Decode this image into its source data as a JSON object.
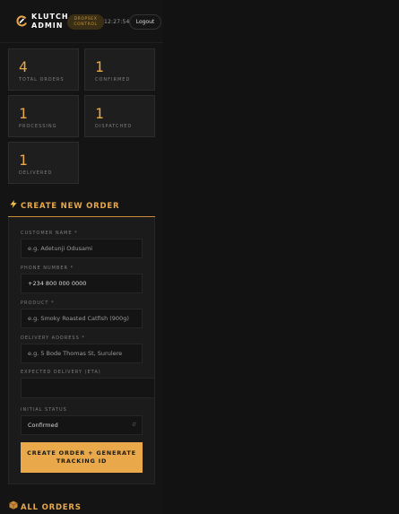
{
  "header": {
    "brand_line1": "KLUTCH",
    "brand_line2": "ADMIN",
    "badge_line1": "DROPSEX",
    "badge_line2": "CONTROL",
    "time": "12:27:54",
    "logout_label": "Logout"
  },
  "stats": [
    {
      "value": "4",
      "label": "TOTAL ORDERS"
    },
    {
      "value": "1",
      "label": "CONFIRMED"
    },
    {
      "value": "1",
      "label": "PROCESSING"
    },
    {
      "value": "1",
      "label": "DISPATCHED"
    },
    {
      "value": "1",
      "label": "DELIVERED"
    }
  ],
  "create_section": {
    "icon": "lightning-icon",
    "title": "CREATE NEW ORDER",
    "customer_label": "CUSTOMER NAME *",
    "customer_placeholder": "e.g. Adetunji Odusami",
    "phone_label": "PHONE NUMBER *",
    "phone_value": "+234 800 000 0000",
    "product_label": "PRODUCT *",
    "product_placeholder": "e.g. Smoky Roasted Catfish (900g)",
    "address_label": "DELIVERY ADDRESS *",
    "address_placeholder": "e.g. 5 Bode Thomas St, Surulere",
    "eta_label": "EXPECTED DELIVERY (ETA)",
    "eta_value": "",
    "status_label": "INITIAL STATUS",
    "status_value": "Confirmed",
    "submit_line1": "CREATE ORDER + GENERATE",
    "submit_line2": "TRACKING ID"
  },
  "orders_section": {
    "icon": "package-icon",
    "title": "ALL ORDERS"
  },
  "colors": {
    "accent": "#e9a84a",
    "background": "#111111",
    "card": "#1e1e1e"
  }
}
